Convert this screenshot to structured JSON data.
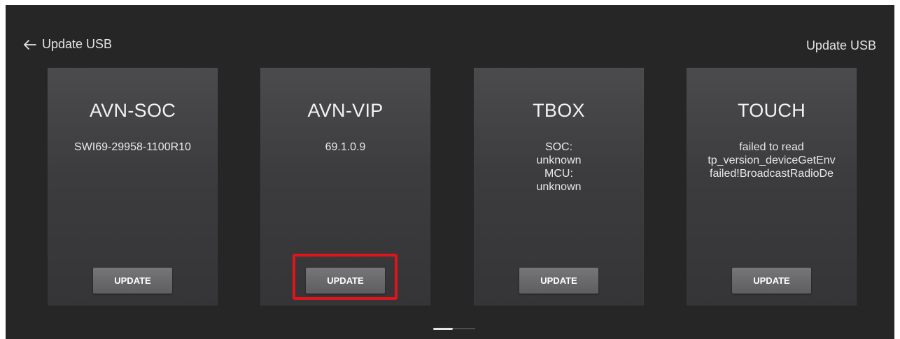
{
  "header": {
    "back_label": "Update USB",
    "back_icon": "arrow-left-icon",
    "right_title": "Update USB"
  },
  "cards": [
    {
      "title": "AVN-SOC",
      "version": "SWI69-29958-1100R10",
      "button": "UPDATE"
    },
    {
      "title": "AVN-VIP",
      "version": "69.1.0.9",
      "button": "UPDATE"
    },
    {
      "title": "TBOX",
      "version": "SOC:\nunknown\nMCU:\nunknown",
      "button": "UPDATE"
    },
    {
      "title": "TOUCH",
      "version": "failed to read\ntp_version_deviceGetEnv\nfailed!BroadcastRadioDe",
      "button": "UPDATE"
    }
  ],
  "annotation": {
    "color": "#e0141b",
    "target": "AVN-VIP update button"
  },
  "pager": {
    "current_page": 1
  }
}
